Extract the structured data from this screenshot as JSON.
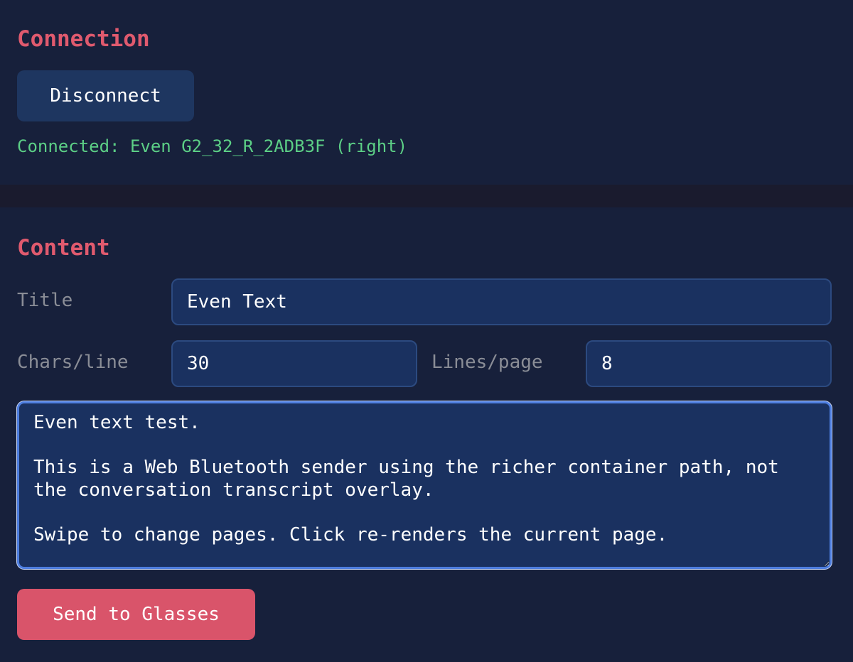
{
  "connection": {
    "title": "Connection",
    "disconnect_label": "Disconnect",
    "status": "Connected: Even G2_32_R_2ADB3F (right)"
  },
  "content": {
    "title": "Content",
    "title_label": "Title",
    "title_value": "Even Text",
    "chars_label": "Chars/line",
    "chars_value": "30",
    "lines_label": "Lines/page",
    "lines_value": "8",
    "body_text": "Even text test.\n\nThis is a Web Bluetooth sender using the richer container path, not the conversation transcript overlay.\n\nSwipe to change pages. Click re-renders the current page.",
    "send_label": "Send to Glasses"
  },
  "colors": {
    "background": "#1a1b2e",
    "panel": "#17203b",
    "accent": "#e05a6e",
    "status_ok": "#5ccf86",
    "input_bg": "#1a3160",
    "button_secondary": "#1e3660",
    "button_primary": "#d9546a"
  }
}
